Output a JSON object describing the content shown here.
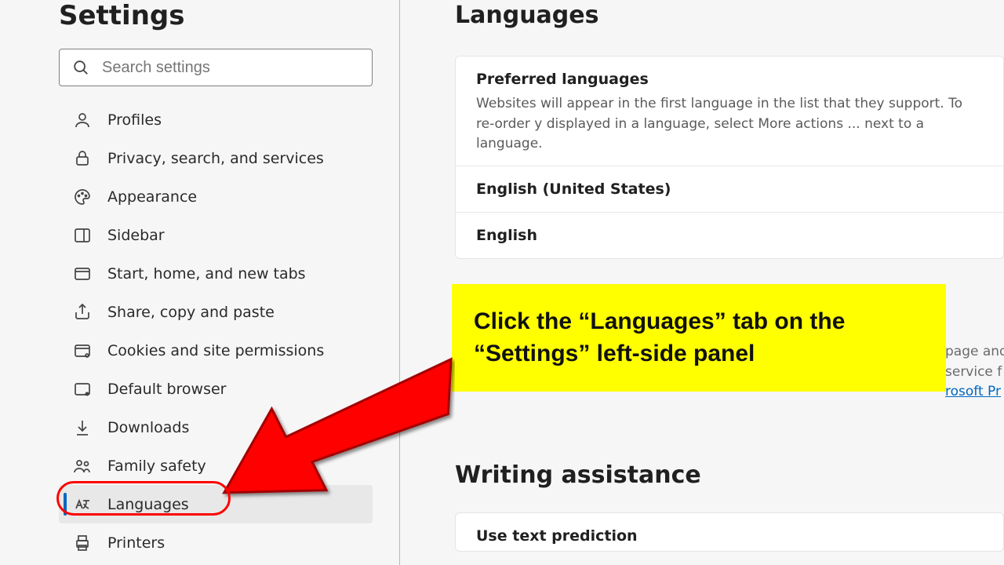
{
  "sidebar": {
    "title": "Settings",
    "search_placeholder": "Search settings",
    "items": [
      {
        "label": "Profiles"
      },
      {
        "label": "Privacy, search, and services"
      },
      {
        "label": "Appearance"
      },
      {
        "label": "Sidebar"
      },
      {
        "label": "Start, home, and new tabs"
      },
      {
        "label": "Share, copy and paste"
      },
      {
        "label": "Cookies and site permissions"
      },
      {
        "label": "Default browser"
      },
      {
        "label": "Downloads"
      },
      {
        "label": "Family safety"
      },
      {
        "label": "Languages"
      },
      {
        "label": "Printers"
      }
    ]
  },
  "main": {
    "section_title": "Languages",
    "preferred": {
      "title": "Preferred languages",
      "desc": "Websites will appear in the first language in the list that they support. To re-order y displayed in a language, select More actions ... next to a language.",
      "langs": [
        "English (United States)",
        "English"
      ]
    },
    "writing_section_title": "Writing assistance",
    "text_prediction_title": "Use text prediction",
    "side_fragment_1": "page and",
    "side_fragment_2": "service f",
    "side_link": "rosoft Pr"
  },
  "annotation": {
    "callout": "Click the “Languages” tab on the “Settings” left-side panel"
  }
}
